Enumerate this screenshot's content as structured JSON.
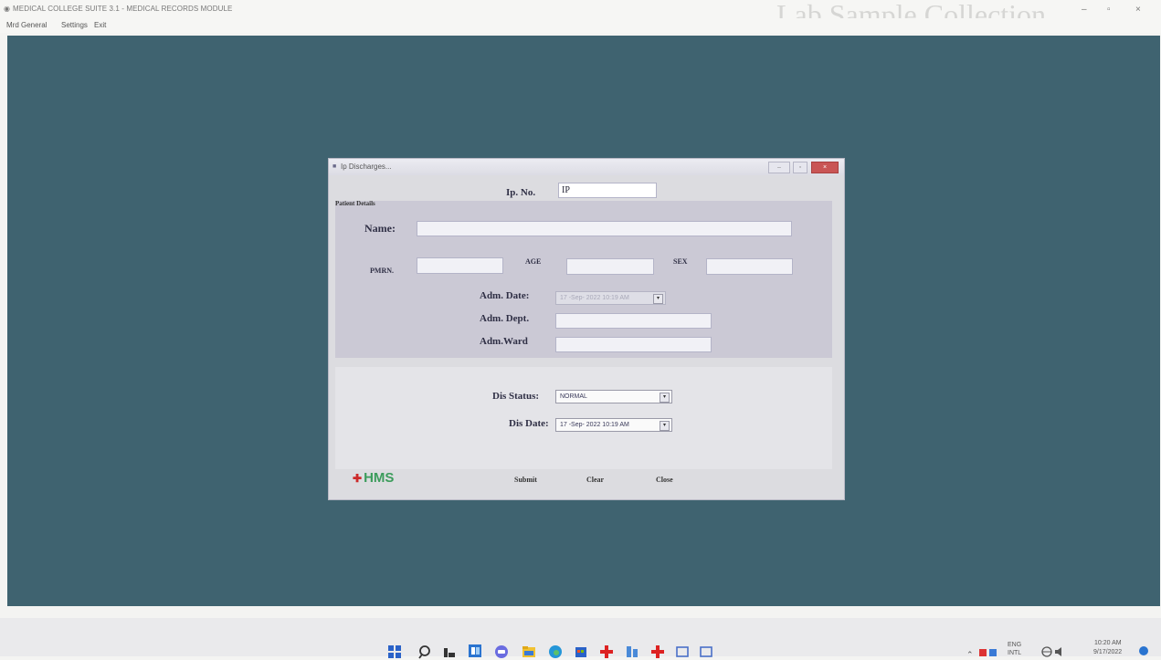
{
  "window": {
    "title": "MEDICAL COLLEGE SUITE 3.1 - MEDICAL RECORDS MODULE",
    "background_text": "Lab Sample Collection",
    "controls": {
      "minimize": "–",
      "maximize": "▫",
      "close": "×"
    }
  },
  "menu": {
    "items": [
      "Mrd General",
      "Settings",
      "Exit"
    ]
  },
  "dialog": {
    "title": "Ip Discharges...",
    "ip_no_label": "Ip. No.",
    "ip_no_value": "IP",
    "patient_panel_title": "Patient Details",
    "name_label": "Name:",
    "name_value": "",
    "pmrn_label": "PMRN.",
    "pmrn_value": "",
    "age_label": "AGE",
    "age_value": "",
    "sex_label": "SEX",
    "sex_value": "",
    "adm_date_label": "Adm. Date:",
    "adm_date_value": "17 -Sep- 2022 10:19 AM",
    "adm_dept_label": "Adm. Dept.",
    "adm_dept_value": "",
    "adm_ward_label": "Adm.Ward",
    "adm_ward_value": "",
    "dis_status_label": "Dis Status:",
    "dis_status_value": "NORMAL",
    "dis_date_label": "Dis Date:",
    "dis_date_value": "17 -Sep- 2022 10:19 AM",
    "logo_text": "HMS",
    "submit_label": "Submit",
    "clear_label": "Clear",
    "close_label": "Close"
  },
  "taskbar": {
    "language": "ENG",
    "language_sub": "INTL",
    "time": "10:20 AM",
    "date": "9/17/2022"
  },
  "colors": {
    "desktop": "#3f6370",
    "dialog": "#dcdce0",
    "patient_panel": "#cbc9d5",
    "hms_green": "#3c9c5c",
    "hms_red": "#cc2a2a"
  }
}
